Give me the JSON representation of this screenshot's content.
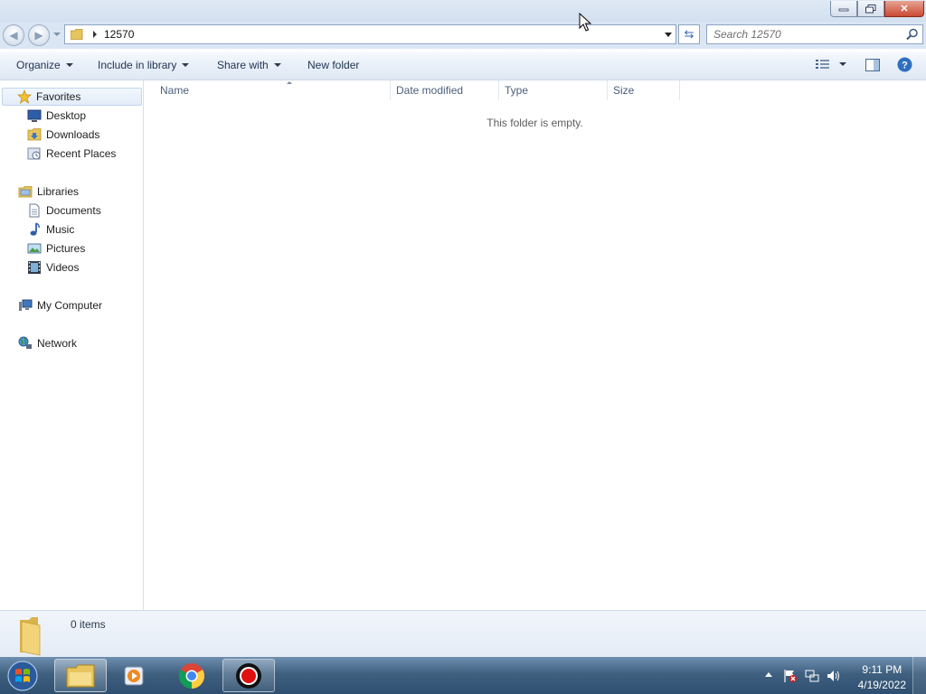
{
  "window": {
    "minimize_label": "▭",
    "restore_label": "❐",
    "close_label": "✕"
  },
  "address_bar": {
    "path": "12570",
    "search_placeholder": "Search 12570"
  },
  "toolbar": {
    "organize": "Organize",
    "include_in_library": "Include in library",
    "share_with": "Share with",
    "new_folder": "New folder"
  },
  "nav_pane": {
    "favorites": {
      "label": "Favorites",
      "items": [
        "Desktop",
        "Downloads",
        "Recent Places"
      ]
    },
    "libraries": {
      "label": "Libraries",
      "items": [
        "Documents",
        "Music",
        "Pictures",
        "Videos"
      ]
    },
    "my_computer": "My Computer",
    "network": "Network"
  },
  "content": {
    "columns": [
      "Name",
      "Date modified",
      "Type",
      "Size"
    ],
    "empty_message": "This folder is empty."
  },
  "details": {
    "item_count": "0 items"
  },
  "taskbar": {
    "time": "9:11 PM",
    "date": "4/19/2022"
  },
  "colors": {
    "accent": "#3a6ea5",
    "close_button": "#c94a33",
    "taskbar": "#3f607f"
  }
}
